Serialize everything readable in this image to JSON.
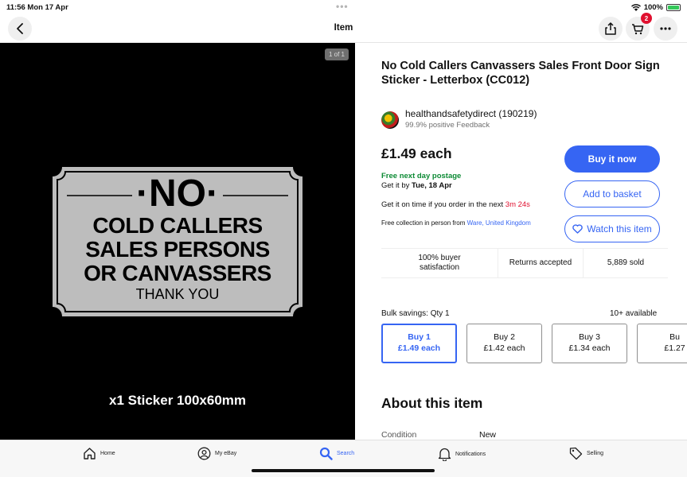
{
  "status_bar": {
    "time_date": "11:56  Mon 17 Apr",
    "battery": "100%"
  },
  "header": {
    "title": "Item",
    "cart_count": "2"
  },
  "image": {
    "counter": "1 of 1",
    "sign_no": "·NO·",
    "sign_line1": "COLD CALLERS",
    "sign_line2": "SALES PERSONS",
    "sign_line3": "OR CANVASSERS",
    "sign_thanks": "THANK YOU",
    "caption": "x1  Sticker  100x60mm"
  },
  "listing": {
    "title": "No Cold Callers Canvassers Sales Front Door Sign Sticker - Letterbox (CC012)",
    "seller_name": "healthandsafetydirect (190219)",
    "seller_feedback": "99.9% positive Feedback",
    "price": "£1.49 each",
    "postage": "Free next day postage",
    "delivery_prefix": "Get it by ",
    "delivery_date": "Tue, 18 Apr",
    "ontime_prefix": "Get it on time if you order in the next ",
    "ontime_countdown": "3m 24s",
    "collection_prefix": "Free collection in person from ",
    "collection_location": "Ware, United Kingdom"
  },
  "actions": {
    "buy_now": "Buy it now",
    "add_to_basket": "Add to basket",
    "watch": "Watch this item"
  },
  "stats": [
    "100% buyer satisfaction",
    "Returns accepted",
    "5,889 sold"
  ],
  "bulk": {
    "label": "Bulk savings: Qty 1",
    "available": "10+ available",
    "options": [
      {
        "qty": "Buy 1",
        "price": "£1.49 each"
      },
      {
        "qty": "Buy 2",
        "price": "£1.42 each"
      },
      {
        "qty": "Buy 3",
        "price": "£1.34 each"
      },
      {
        "qty": "Bu",
        "price": "£1.27"
      }
    ]
  },
  "about": {
    "heading": "About this item",
    "condition_label": "Condition",
    "condition_value": "New"
  },
  "tabbar": {
    "home": "Home",
    "my_ebay": "My eBay",
    "search": "Search",
    "notifications": "Notifications",
    "selling": "Selling"
  },
  "colors": {
    "accent": "#3665f3",
    "green": "#0c8a34",
    "red": "#e0102f"
  }
}
